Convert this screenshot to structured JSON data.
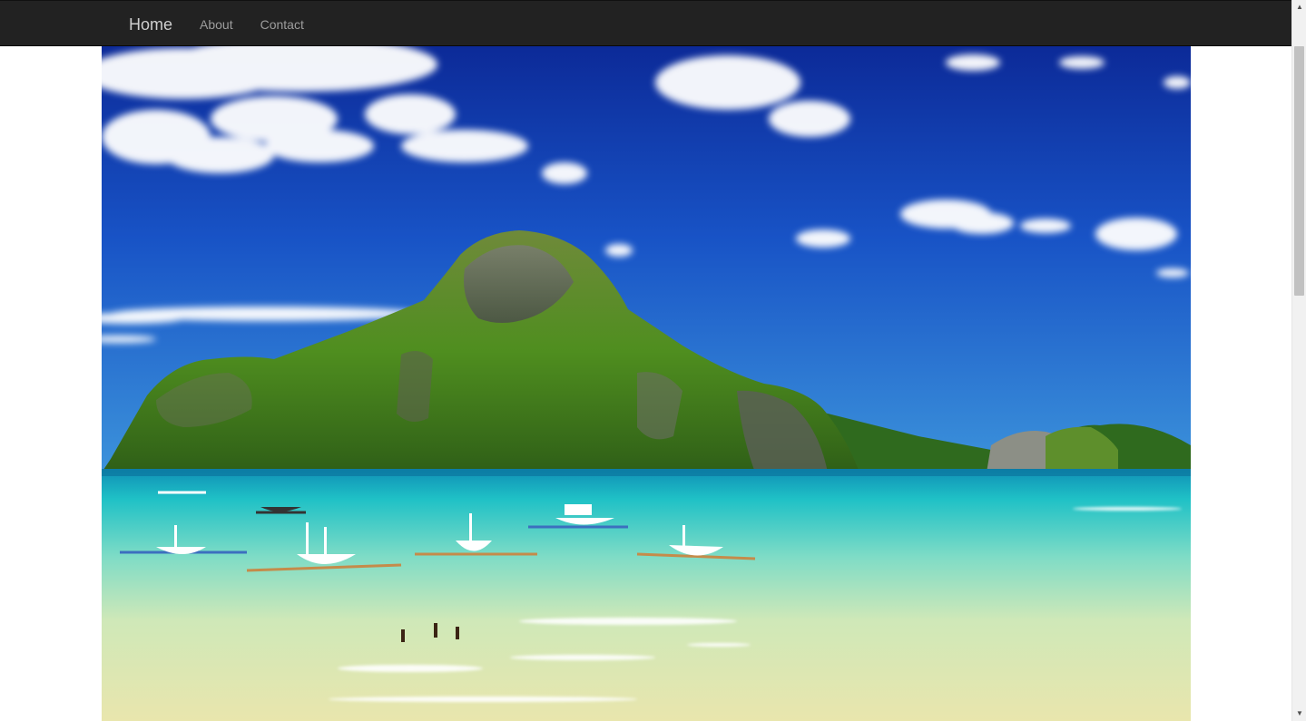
{
  "navbar": {
    "brand": "Home",
    "links": [
      {
        "label": "About"
      },
      {
        "label": "Contact"
      }
    ]
  },
  "hero": {
    "icon": "beach-island-photo"
  },
  "colors": {
    "navbar_bg": "#222222",
    "nav_text": "#9d9d9d",
    "sky_top": "#0d2f9e",
    "sky_bottom": "#3b8fd9",
    "sea": "#27c3c4",
    "sand": "#e8e6b0",
    "island": "#4f8f1f"
  }
}
